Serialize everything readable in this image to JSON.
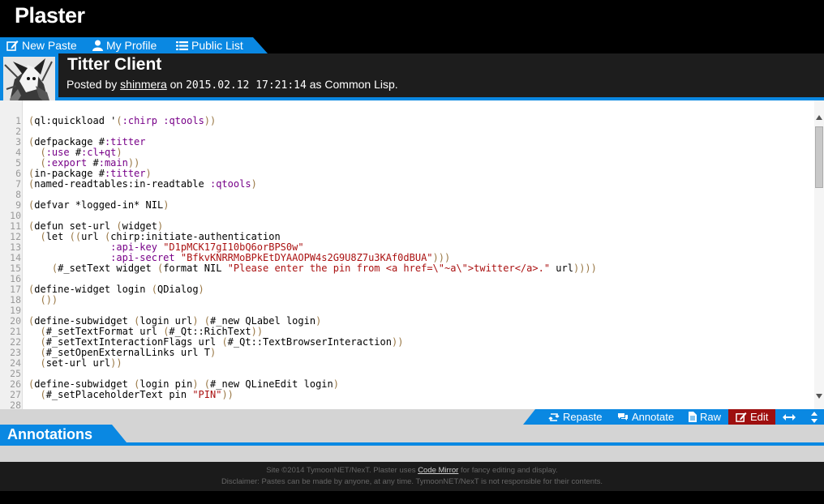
{
  "app": {
    "title": "Plaster"
  },
  "nav": {
    "new_paste": "New Paste",
    "my_profile": "My Profile",
    "public_list": "Public List"
  },
  "paste": {
    "title": "Titter Client",
    "posted_by": "Posted by",
    "author": "shinmera",
    "on": "on",
    "datetime": "2015.02.12 17:21:14",
    "as": "as Common Lisp."
  },
  "code_lines": [
    "(ql:quickload '(:chirp :qtools))",
    "",
    "(defpackage #:titter",
    "  (:use #:cl+qt)",
    "  (:export #:main))",
    "(in-package #:titter)",
    "(named-readtables:in-readtable :qtools)",
    "",
    "(defvar *logged-in* NIL)",
    "",
    "(defun set-url (widget)",
    "  (let ((url (chirp:initiate-authentication",
    "              :api-key \"D1pMCK17gI10bQ6orBPS0w\"",
    "              :api-secret \"BfkvKNRRMoBPkEtDYAAOPW4s2G9U8Z7u3KAf0dBUA\")))",
    "    (#_setText widget (format NIL \"Please enter the pin from <a href=\\\"~a\\\">twitter</a>.\" url))))",
    "",
    "(define-widget login (QDialog)",
    "  ())",
    "",
    "(define-subwidget (login url) (#_new QLabel login)",
    "  (#_setTextFormat url (#_Qt::RichText))",
    "  (#_setTextInteractionFlags url (#_Qt::TextBrowserInteraction))",
    "  (#_setOpenExternalLinks url T)",
    "  (set-url url))",
    "",
    "(define-subwidget (login pin) (#_new QLineEdit login)",
    "  (#_setPlaceholderText pin \"PIN\"))",
    ""
  ],
  "toolbar": {
    "repaste": "Repaste",
    "annotate": "Annotate",
    "raw": "Raw",
    "edit": "Edit"
  },
  "annotations": {
    "title": "Annotations"
  },
  "footer": {
    "line1_prefix": "Site ©2014 TymoonNET/NexT. Plaster uses",
    "code_mirror": "Code Mirror",
    "line1_suffix": "for fancy editing and display.",
    "line2": "Disclaimer: Pastes can be made by anyone, at any time. TymoonNET/NexT is not responsible for their contents."
  },
  "colors": {
    "accent": "#0a88e2",
    "header_bg": "#1d1d1d",
    "edit_button": "#9e0f0f",
    "keyword": "#770088",
    "string": "#aa1111",
    "paren": "#997744"
  }
}
